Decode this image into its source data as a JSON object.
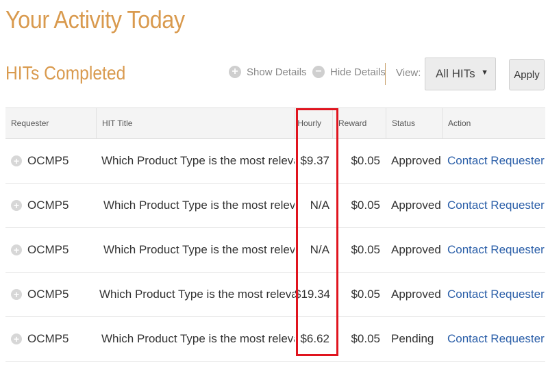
{
  "header": {
    "title": "Your Activity Today"
  },
  "section": {
    "title": "HITs Completed",
    "show_details_label": "Show Details",
    "hide_details_label": "Hide Details",
    "view_label": "View:",
    "view_selected": "All HITs",
    "apply_label": "Apply"
  },
  "table": {
    "columns": [
      "Requester",
      "HIT Title",
      "Hourly",
      "Reward",
      "Status",
      "Action"
    ],
    "rows": [
      {
        "requester": "OCMP5",
        "title": "Which Product Type is the most relevant?...",
        "hourly": "$9.37",
        "reward": "$0.05",
        "status": "Approved",
        "action": "Contact Requester"
      },
      {
        "requester": "OCMP5",
        "title": "Which Product Type is the most relevant? (...",
        "hourly": "N/A",
        "reward": "$0.05",
        "status": "Approved",
        "action": "Contact Requester"
      },
      {
        "requester": "OCMP5",
        "title": "Which Product Type is the most relevant? (...",
        "hourly": "N/A",
        "reward": "$0.05",
        "status": "Approved",
        "action": "Contact Requester"
      },
      {
        "requester": "OCMP5",
        "title": "Which Product Type is the most relevant...",
        "hourly": "$19.34",
        "reward": "$0.05",
        "status": "Approved",
        "action": "Contact Requester"
      },
      {
        "requester": "OCMP5",
        "title": "Which Product Type is the most relevant?...",
        "hourly": "$6.62",
        "reward": "$0.05",
        "status": "Pending",
        "action": "Contact Requester"
      }
    ]
  },
  "colors": {
    "accent": "#d99a4e",
    "link": "#2a5ea8",
    "highlight": "#e0141e"
  },
  "icons": {
    "expand": "plus-circle-icon",
    "collapse": "minus-circle-icon",
    "dropdown": "caret-down-icon"
  }
}
